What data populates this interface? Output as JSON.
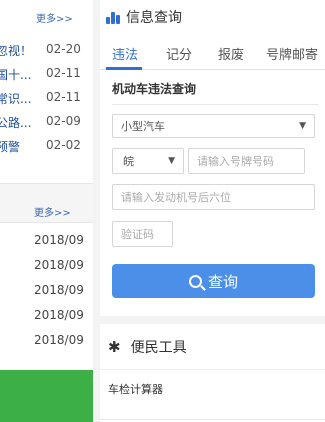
{
  "left": {
    "more_top": "更多>>",
    "news": [
      {
        "title": "忽视！",
        "date": "02-20"
      },
      {
        "title": "国十...",
        "date": "02-11"
      },
      {
        "title": "常识...",
        "date": "02-11"
      },
      {
        "title": "公路...",
        "date": "02-09"
      },
      {
        "title": "预警",
        "date": "02-02"
      }
    ],
    "more_bottom": "更多>>",
    "dates": [
      "2018/09",
      "2018/09",
      "2018/09",
      "2018/09",
      "2018/09"
    ]
  },
  "panel": {
    "title": "信息查询",
    "tabs": [
      "违法",
      "记分",
      "报废",
      "号牌邮寄"
    ],
    "subtitle": "机动车违法查询",
    "vehicle_type": "小型汽车",
    "province": "皖",
    "plate_placeholder": "请输入号牌号码",
    "engine_placeholder": "请输入发动机号后六位",
    "captcha_placeholder": "验证码",
    "query_button": "查询"
  },
  "tools": {
    "title": "便民工具",
    "items": [
      "车检计算器"
    ]
  }
}
